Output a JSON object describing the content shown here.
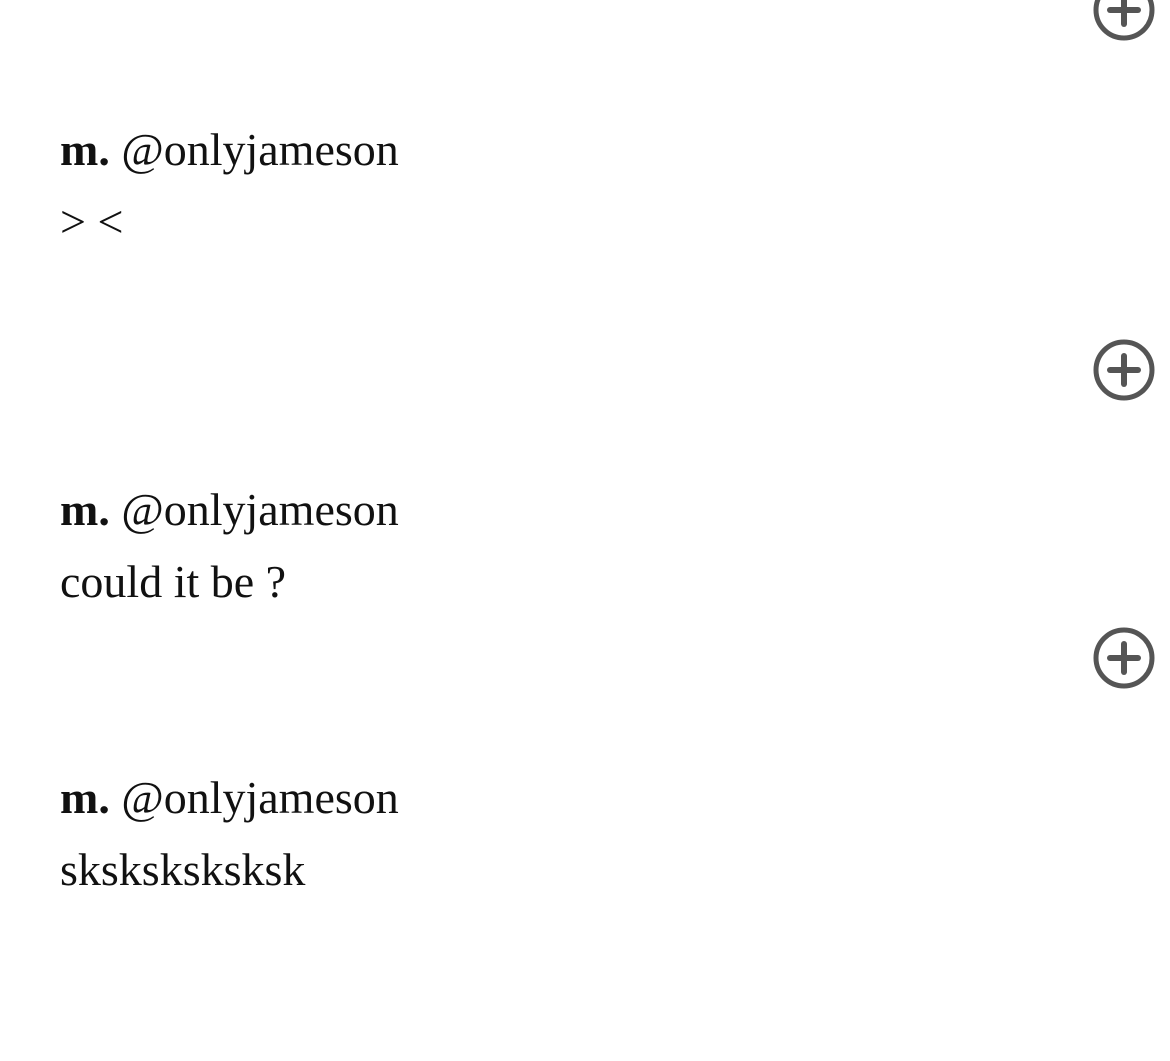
{
  "entries": [
    {
      "name": "m.",
      "handle": "@onlyjameson",
      "message": "> <"
    },
    {
      "name": "m.",
      "handle": "@onlyjameson",
      "message": "could it be ?"
    },
    {
      "name": "m.",
      "handle": "@onlyjameson",
      "message": "sksksksksksk"
    }
  ],
  "add_icon": "plus-circle-icon",
  "icon_color": "#555555"
}
